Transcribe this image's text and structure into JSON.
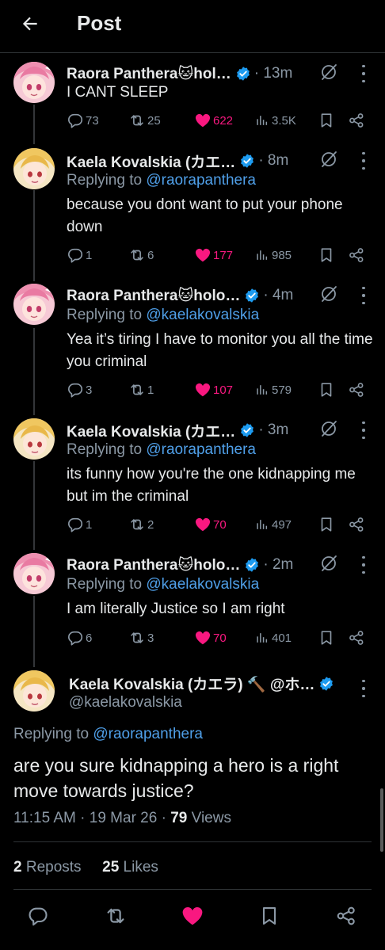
{
  "header": {
    "title": "Post"
  },
  "colors": {
    "accent": "#4f9fe8",
    "like": "#f91880",
    "muted": "#8b98a5",
    "verified": "#1d9bf0"
  },
  "thread": [
    {
      "author": "Raora Panthera🐱hol…",
      "time": "· 13m",
      "reply_prefix": "",
      "reply_to": "",
      "text": "I CANT SLEEP",
      "replies": "73",
      "reposts": "25",
      "likes": "622",
      "views": "3.5K"
    },
    {
      "author": "Kaela Kovalskia (カエ…",
      "time": "· 8m",
      "reply_prefix": "Replying to",
      "reply_to": "@raorapanthera",
      "text": "because you dont want to put your phone down",
      "replies": "1",
      "reposts": "6",
      "likes": "177",
      "views": "985"
    },
    {
      "author": "Raora Panthera🐱holo…",
      "time": "· 4m",
      "reply_prefix": "Replying to",
      "reply_to": "@kaelakovalskia",
      "text": "Yea it’s tiring I have to monitor you all the time you criminal",
      "replies": "3",
      "reposts": "1",
      "likes": "107",
      "views": "579"
    },
    {
      "author": "Kaela Kovalskia (カエ…",
      "time": "· 3m",
      "reply_prefix": "Replying to",
      "reply_to": "@raorapanthera",
      "text": "its funny how you're the one kidnapping me but im the criminal",
      "replies": "1",
      "reposts": "2",
      "likes": "70",
      "views": "497"
    },
    {
      "author": "Raora Panthera🐱holo…",
      "time": "· 2m",
      "reply_prefix": "Replying to",
      "reply_to": "@kaelakovalskia",
      "text": "I am literally Justice so I am right",
      "replies": "6",
      "reposts": "3",
      "likes": "70",
      "views": "401"
    }
  ],
  "main": {
    "author": "Kaela Kovalskia (カエラ) 🔨 @ホ…",
    "handle": "@kaelakovalskia",
    "reply_prefix": "Replying to",
    "reply_to": "@raorapanthera",
    "text": "are you sure kidnapping a hero is a right move towards justice?",
    "time": "11:15 AM",
    "date": "19 Mar 26",
    "views_count": "79",
    "views_label": "Views",
    "reposts_count": "2",
    "reposts_label": "Reposts",
    "likes_count": "25",
    "likes_label": "Likes"
  },
  "icons": {
    "back": "arrow-left-icon",
    "grok": "grok-icon",
    "more": "more-vertical-icon",
    "reply": "reply-icon",
    "repost": "repost-icon",
    "like": "heart-icon",
    "views": "views-icon",
    "bookmark": "bookmark-icon",
    "share": "share-icon",
    "verified": "verified-badge-icon"
  }
}
